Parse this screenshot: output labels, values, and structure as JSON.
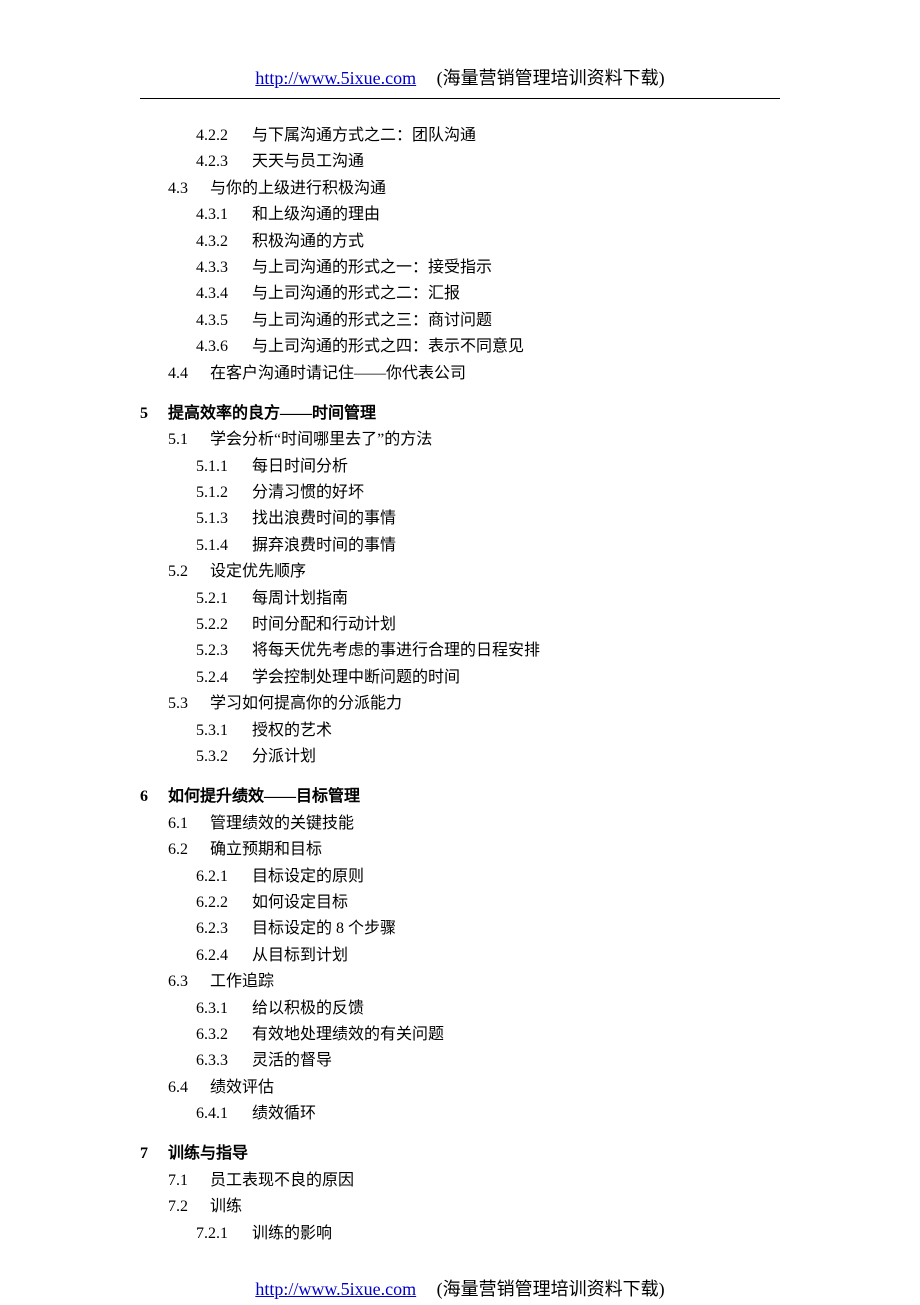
{
  "header": {
    "url_text": "http://www.5ixue.com",
    "tagline": "(海量营销管理培训资料下载)"
  },
  "footer": {
    "url_text": "http://www.5ixue.com",
    "tagline": "(海量营销管理培训资料下载)"
  },
  "toc": [
    {
      "level": 2,
      "num": "4.2.2",
      "title": "与下属沟通方式之二：团队沟通"
    },
    {
      "level": 2,
      "num": "4.2.3",
      "title": "天天与员工沟通"
    },
    {
      "level": 1,
      "num": "4.3",
      "title": "与你的上级进行积极沟通"
    },
    {
      "level": 2,
      "num": "4.3.1",
      "title": "和上级沟通的理由"
    },
    {
      "level": 2,
      "num": "4.3.2",
      "title": "积极沟通的方式"
    },
    {
      "level": 2,
      "num": "4.3.3",
      "title": "与上司沟通的形式之一：接受指示"
    },
    {
      "level": 2,
      "num": "4.3.4",
      "title": "与上司沟通的形式之二：汇报"
    },
    {
      "level": 2,
      "num": "4.3.5",
      "title": "与上司沟通的形式之三：商讨问题"
    },
    {
      "level": 2,
      "num": "4.3.6",
      "title": "与上司沟通的形式之四：表示不同意见"
    },
    {
      "level": 1,
      "num": "4.4",
      "title": "在客户沟通时请记住——你代表公司"
    },
    {
      "level": 0,
      "num": "5",
      "title": "提高效率的良方——时间管理"
    },
    {
      "level": 1,
      "num": "5.1",
      "title": "学会分析“时间哪里去了”的方法"
    },
    {
      "level": 2,
      "num": "5.1.1",
      "title": "每日时间分析"
    },
    {
      "level": 2,
      "num": "5.1.2",
      "title": "分清习惯的好坏"
    },
    {
      "level": 2,
      "num": "5.1.3",
      "title": "找出浪费时间的事情"
    },
    {
      "level": 2,
      "num": "5.1.4",
      "title": "摒弃浪费时间的事情"
    },
    {
      "level": 1,
      "num": "5.2",
      "title": "设定优先顺序"
    },
    {
      "level": 2,
      "num": "5.2.1",
      "title": "每周计划指南"
    },
    {
      "level": 2,
      "num": "5.2.2",
      "title": "时间分配和行动计划"
    },
    {
      "level": 2,
      "num": "5.2.3",
      "title": "将每天优先考虑的事进行合理的日程安排"
    },
    {
      "level": 2,
      "num": "5.2.4",
      "title": "学会控制处理中断问题的时间"
    },
    {
      "level": 1,
      "num": "5.3",
      "title": "学习如何提高你的分派能力"
    },
    {
      "level": 2,
      "num": "5.3.1",
      "title": "授权的艺术"
    },
    {
      "level": 2,
      "num": "5.3.2",
      "title": "分派计划"
    },
    {
      "level": 0,
      "num": "6",
      "title": "如何提升绩效——目标管理"
    },
    {
      "level": 1,
      "num": "6.1",
      "title": "管理绩效的关键技能"
    },
    {
      "level": 1,
      "num": "6.2",
      "title": "确立预期和目标"
    },
    {
      "level": 2,
      "num": "6.2.1",
      "title": "目标设定的原则"
    },
    {
      "level": 2,
      "num": "6.2.2",
      "title": "如何设定目标"
    },
    {
      "level": 2,
      "num": "6.2.3",
      "title": "目标设定的 8 个步骤"
    },
    {
      "level": 2,
      "num": "6.2.4",
      "title": "从目标到计划"
    },
    {
      "level": 1,
      "num": "6.3",
      "title": "工作追踪"
    },
    {
      "level": 2,
      "num": "6.3.1",
      "title": "给以积极的反馈"
    },
    {
      "level": 2,
      "num": "6.3.2",
      "title": "有效地处理绩效的有关问题"
    },
    {
      "level": 2,
      "num": "6.3.3",
      "title": "灵活的督导"
    },
    {
      "level": 1,
      "num": "6.4",
      "title": "绩效评估"
    },
    {
      "level": 2,
      "num": "6.4.1",
      "title": "绩效循环"
    },
    {
      "level": 0,
      "num": "7",
      "title": "训练与指导"
    },
    {
      "level": 1,
      "num": "7.1",
      "title": "员工表现不良的原因"
    },
    {
      "level": 1,
      "num": "7.2",
      "title": "训练"
    },
    {
      "level": 2,
      "num": "7.2.1",
      "title": "训练的影响"
    }
  ]
}
